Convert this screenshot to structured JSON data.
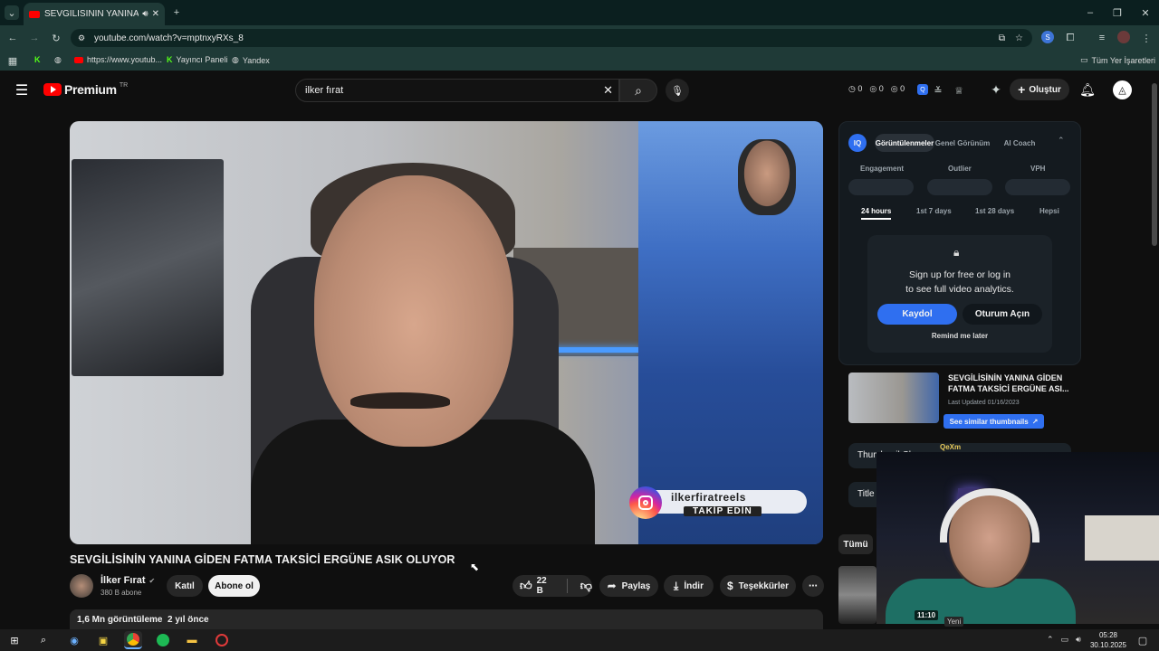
{
  "browser": {
    "tab_title": "SEVGİLİSİNİN YANINA GİDE",
    "url": "youtube.com/watch?v=mptnxyRXs_8",
    "bookmarks": [
      "https://www.youtub...",
      "Yayıncı Paneli",
      "Yandex"
    ],
    "bookmarks_right": "Tüm Yer İşaretleri"
  },
  "yt": {
    "brand": "Premium",
    "brand_region": "TR",
    "search_query": "ilker fırat",
    "counters": [
      "0",
      "0",
      "0"
    ],
    "create_label": "Oluştur",
    "video_title": "SEVGİLİSİNİN YANINA GİDEN FATMA TAKSİCİ ERGÜNE ASIK OLUYOR",
    "channel_name": "İlker Fırat",
    "subscribers": "380 B abone",
    "join_label": "Katıl",
    "subscribe_label": "Abone ol",
    "likes": "22 B",
    "share_label": "Paylaş",
    "download_label": "İndir",
    "thanks_label": "Teşekkürler",
    "views_line": "1,6 Mn görüntüleme  2 yıl önce",
    "overlay_handle": "ilkerfiratreels",
    "overlay_follow": "TAKİP EDİN",
    "chip_all": "Tümü",
    "new_badge": "Yeni",
    "duration": "11:10"
  },
  "panel": {
    "logo": "IQ",
    "segments": [
      "Görüntülenmeler",
      "Genel Görünüm",
      "AI Coach"
    ],
    "stats": [
      "Engagement",
      "Outlier",
      "VPH"
    ],
    "ranges": [
      "24 hours",
      "1st 7 days",
      "1st 28 days",
      "Hepsi"
    ],
    "lock_line1": "Sign up for free or log in",
    "lock_line2": "to see full video analytics.",
    "signup_label": "Kaydol",
    "login_label": "Oturum Açın",
    "remind_label": "Remind me later",
    "thumb_title": "SEVGİLİSİNİN YANINA GİDEN FATMA TAKSİCİ ERGÜNE ASI...",
    "last_updated": "Last Updated 01/16/2023",
    "similar_label": "See similar thumbnails",
    "accordion_1": "Thumbnail Changes",
    "accordion_2": "Title",
    "overlay_user": "QeXm"
  },
  "taskbar": {
    "time": "05:28",
    "date": "30.10.2025"
  },
  "colors": {
    "accent": "#2f6ff0",
    "yt_red": "#ff0000",
    "bg": "#0f0f0f"
  }
}
